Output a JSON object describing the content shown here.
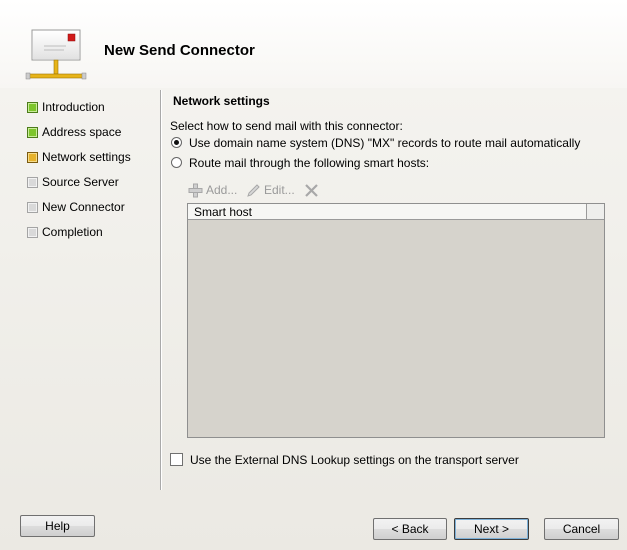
{
  "wizard": {
    "title": "New Send Connector"
  },
  "steps": [
    {
      "label": "Introduction",
      "state": "done"
    },
    {
      "label": "Address space",
      "state": "done"
    },
    {
      "label": "Network settings",
      "state": "current"
    },
    {
      "label": "Source Server",
      "state": "pending"
    },
    {
      "label": "New Connector",
      "state": "pending"
    },
    {
      "label": "Completion",
      "state": "pending"
    }
  ],
  "network": {
    "section_title": "Network settings",
    "prompt": "Select how to send mail with this connector:",
    "option_dns": "Use domain name system (DNS) \"MX\" records to route mail automatically",
    "option_smarthost": "Route mail through the following smart hosts:",
    "selected_option": "dns",
    "toolbar": {
      "add_label": "Add...",
      "edit_label": "Edit..."
    },
    "grid": {
      "columns": [
        "Smart host"
      ],
      "rows": []
    },
    "external_dns_label": "Use the External DNS Lookup settings on the transport server",
    "external_dns_checked": false
  },
  "buttons": {
    "help": "Help",
    "back": "< Back",
    "next": "Next >",
    "cancel": "Cancel"
  },
  "colors": {
    "step_done": "#7dc52b",
    "step_current": "#e6b22b",
    "step_pending": "#d9d9d9",
    "grid_background": "#d6d3cc"
  }
}
